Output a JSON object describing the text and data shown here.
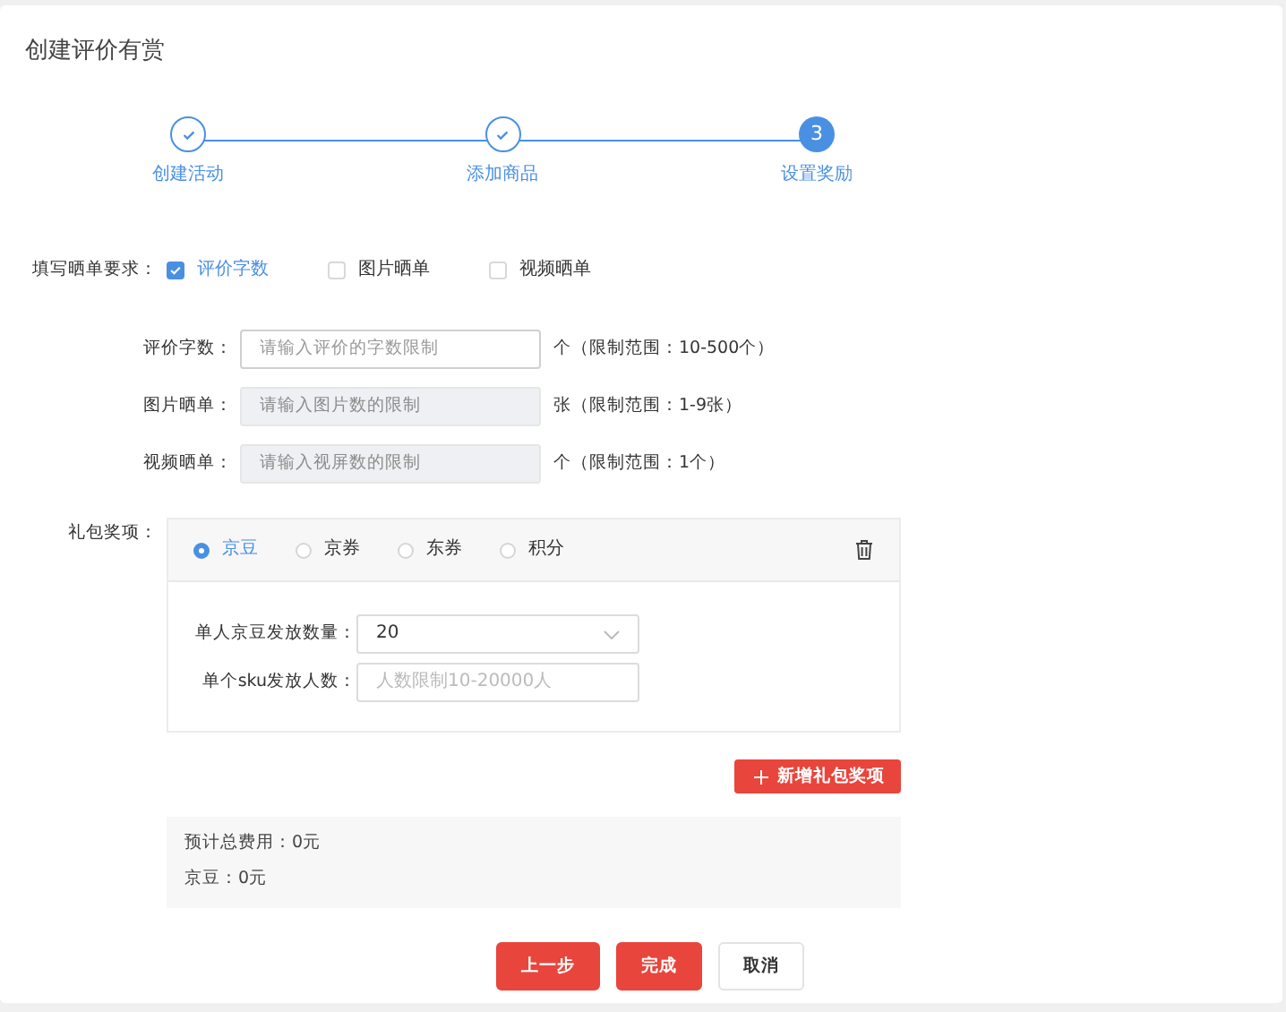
{
  "page": {
    "title": "创建评价有赏"
  },
  "steps": [
    {
      "label": "创建活动",
      "completed": true
    },
    {
      "label": "添加商品",
      "completed": true
    },
    {
      "label": "设置奖励",
      "completed": false,
      "number": "3"
    }
  ],
  "requirements": {
    "label": "填写晒单要求：",
    "options": [
      {
        "label": "评价字数",
        "checked": true
      },
      {
        "label": "图片晒单",
        "checked": false
      },
      {
        "label": "视频晒单",
        "checked": false
      }
    ]
  },
  "limits": [
    {
      "label": "评价字数：",
      "placeholder": "请输入评价的字数限制",
      "disabled": false,
      "hint": "个（限制范围：10-500个）"
    },
    {
      "label": "图片晒单：",
      "placeholder": "请输入图片数的限制",
      "disabled": true,
      "hint": "张（限制范围：1-9张）"
    },
    {
      "label": "视频晒单：",
      "placeholder": "请输入视屏数的限制",
      "disabled": true,
      "hint": "个（限制范围：1个）"
    }
  ],
  "gift": {
    "label": "礼包奖项：",
    "types": [
      {
        "label": "京豆",
        "selected": true
      },
      {
        "label": "京券",
        "selected": false
      },
      {
        "label": "东券",
        "selected": false
      },
      {
        "label": "积分",
        "selected": false
      }
    ],
    "fields": [
      {
        "kind": "select",
        "label": "单人京豆发放数量：",
        "value": "20"
      },
      {
        "kind": "input",
        "label": "单个sku发放人数：",
        "placeholder": "人数限制10-20000人"
      }
    ]
  },
  "add_button": {
    "label": "新增礼包奖项"
  },
  "summary": [
    "预计总费用：0元",
    "京豆：0元"
  ],
  "buttons": [
    {
      "label": "上一步",
      "kind": "primary"
    },
    {
      "label": "完成",
      "kind": "primary"
    },
    {
      "label": "取消",
      "kind": "default"
    }
  ]
}
